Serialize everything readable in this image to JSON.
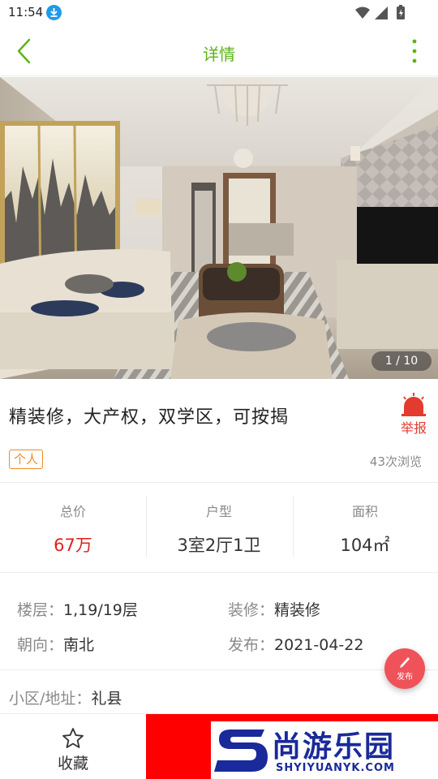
{
  "status_bar": {
    "time": "11:54"
  },
  "header": {
    "title": "详情"
  },
  "gallery": {
    "counter": "1 / 10"
  },
  "listing": {
    "title": "精装修，大产权，双学区，可按揭",
    "report_label": "举报",
    "tag": "个人",
    "views": "43次浏览"
  },
  "stats": [
    {
      "label": "总价",
      "value": "67万"
    },
    {
      "label": "户型",
      "value": "3室2厅1卫"
    },
    {
      "label": "面积",
      "value": "104㎡"
    }
  ],
  "details": {
    "floor_key": "楼层：",
    "floor_val": "1,19/19层",
    "decor_key": "装修：",
    "decor_val": "精装修",
    "orient_key": "朝向：",
    "orient_val": "南北",
    "publish_key": "发布：",
    "publish_val": "2021-04-22",
    "address_key": "小区/地址：",
    "address_val": "礼县"
  },
  "fab": {
    "label": "发布"
  },
  "bottom_bar": {
    "favorite_label": "收藏"
  },
  "watermark": {
    "cn": "尚游乐园",
    "en": "SHYIYUANYK.COM"
  },
  "colors": {
    "accent_green": "#5bb318",
    "price_red": "#e02020",
    "tag_orange": "#f08a24",
    "fab_red": "#f0525a"
  }
}
